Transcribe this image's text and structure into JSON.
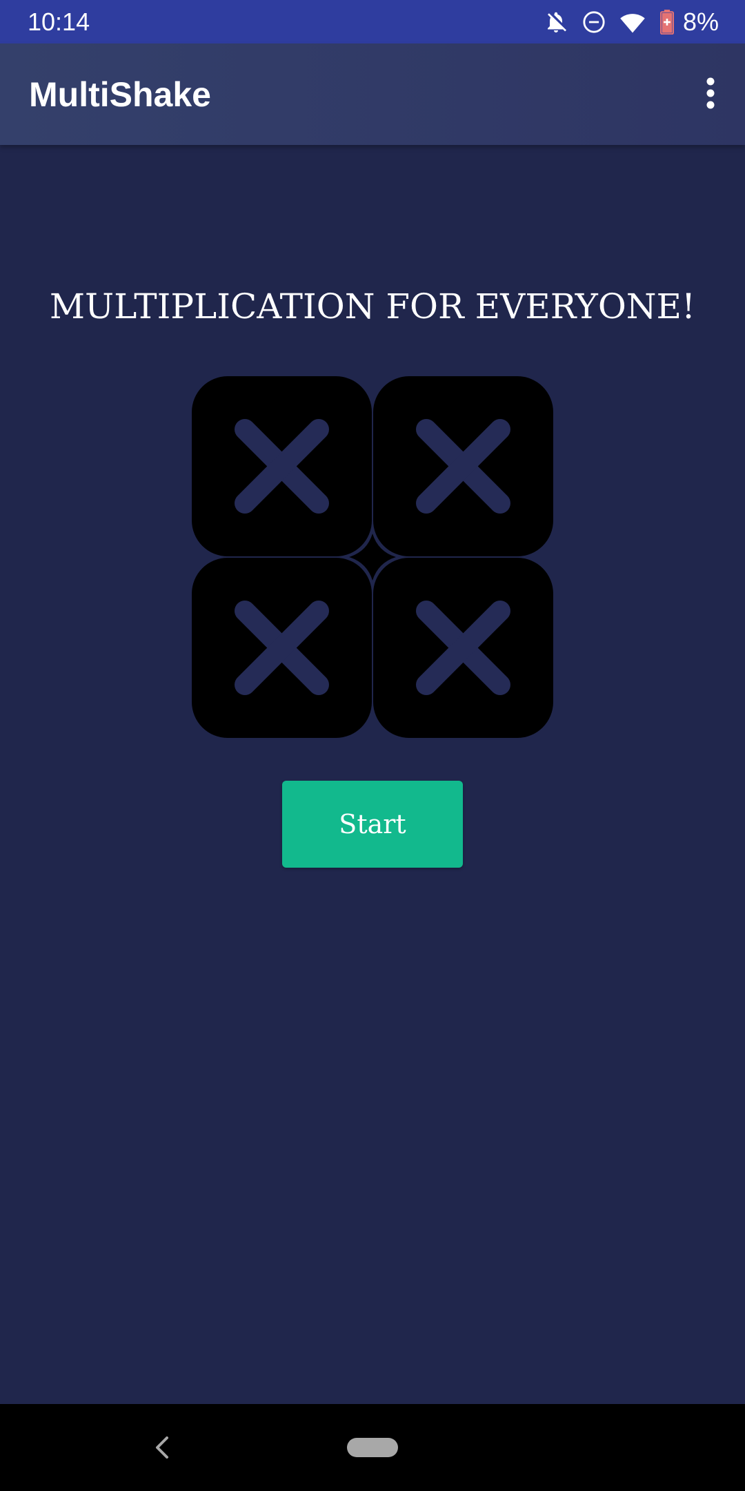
{
  "status_bar": {
    "time": "10:14",
    "battery_percent": "8%",
    "icons": [
      "notifications-off-icon",
      "do-not-disturb-icon",
      "wifi-icon",
      "battery-low-icon"
    ]
  },
  "app_bar": {
    "title": "MultiShake",
    "overflow_icon": "more-vert-icon"
  },
  "main": {
    "headline": "MULTIPLICATION FOR EVERYONE!",
    "logo_icon": "multiplication-tiles-logo",
    "start_label": "Start"
  },
  "nav_bar": {
    "back_icon": "back-icon",
    "home_icon": "home-pill-icon"
  },
  "colors": {
    "status_bar": "#2f3d9f",
    "app_bar": "#333d6a",
    "background": "#20264c",
    "accent": "#12b98d",
    "tile": "#000000",
    "tile_cross": "#252b56"
  }
}
